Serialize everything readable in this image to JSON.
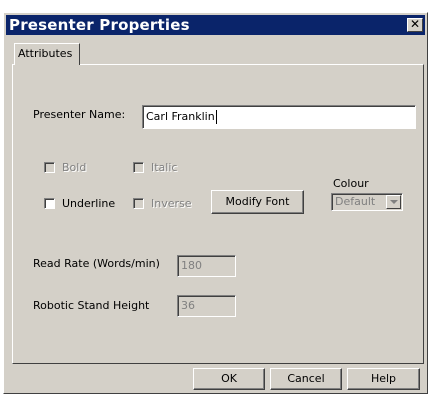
{
  "window": {
    "title": "Presenter Properties",
    "close_glyph": "✕"
  },
  "tabs": [
    {
      "label": "Attributes",
      "selected": true
    }
  ],
  "form": {
    "presenter_name_label": "Presenter Name:",
    "presenter_name_value": "Carl Franklin",
    "bold_label": "Bold",
    "italic_label": "Italic",
    "underline_label": "Underline",
    "inverse_label": "Inverse",
    "modify_font_label": "Modify Font",
    "colour_label": "Colour",
    "colour_value": "Default",
    "read_rate_label": "Read Rate (Words/min)",
    "read_rate_value": "180",
    "stand_height_label": "Robotic Stand Height",
    "stand_height_value": "36"
  },
  "buttons": {
    "ok_label": "OK",
    "cancel_label": "Cancel",
    "help_label": "Help"
  },
  "colors": {
    "title_bar": "#0a246a",
    "dialog_face": "#d4d0c8"
  },
  "icons": {
    "close": "close-icon",
    "dropdown": "chevron-down-icon"
  }
}
